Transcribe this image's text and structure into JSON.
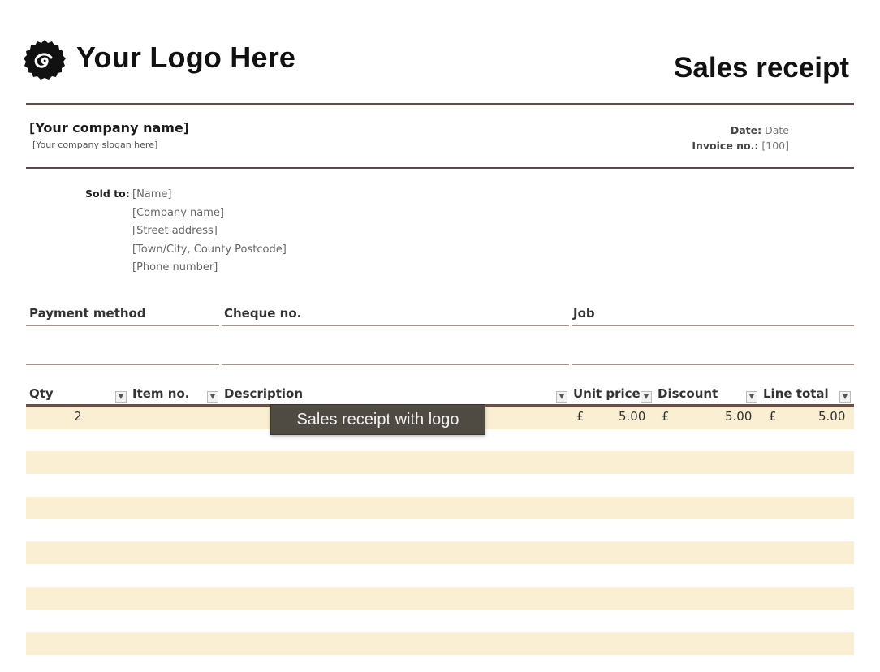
{
  "header": {
    "logo_icon": "spiral-badge-icon",
    "logo_text": "Your Logo Here",
    "title": "Sales receipt"
  },
  "company": {
    "name": "[Your company name]",
    "slogan": "[Your company slogan here]"
  },
  "meta": {
    "date_label": "Date:",
    "date_value": "Date",
    "invoice_label": "Invoice no.:",
    "invoice_value": "[100]"
  },
  "sold_to": {
    "label": "Sold to:",
    "lines": [
      "[Name]",
      "[Company name]",
      "[Street address]",
      "[Town/City, County Postcode]",
      "[Phone number]"
    ]
  },
  "fields": {
    "payment_method": "Payment method",
    "cheque_no": "Cheque no.",
    "job": "Job"
  },
  "table": {
    "columns": [
      "Qty",
      "Item no.",
      "Description",
      "Unit price",
      "Discount",
      "Line total"
    ],
    "dropdown_icon": "filter-dropdown-icon",
    "rows": [
      {
        "qty": "2",
        "item_no": "",
        "description": "",
        "unit_price_currency": "£",
        "unit_price": "5.00",
        "discount_currency": "£",
        "discount": "5.00",
        "line_total_currency": "£",
        "line_total": "5.00"
      }
    ],
    "row_fill_color": "#faefd3",
    "header_rule_color": "#6b5148"
  },
  "tooltip": {
    "text": "Sales receipt with logo"
  }
}
